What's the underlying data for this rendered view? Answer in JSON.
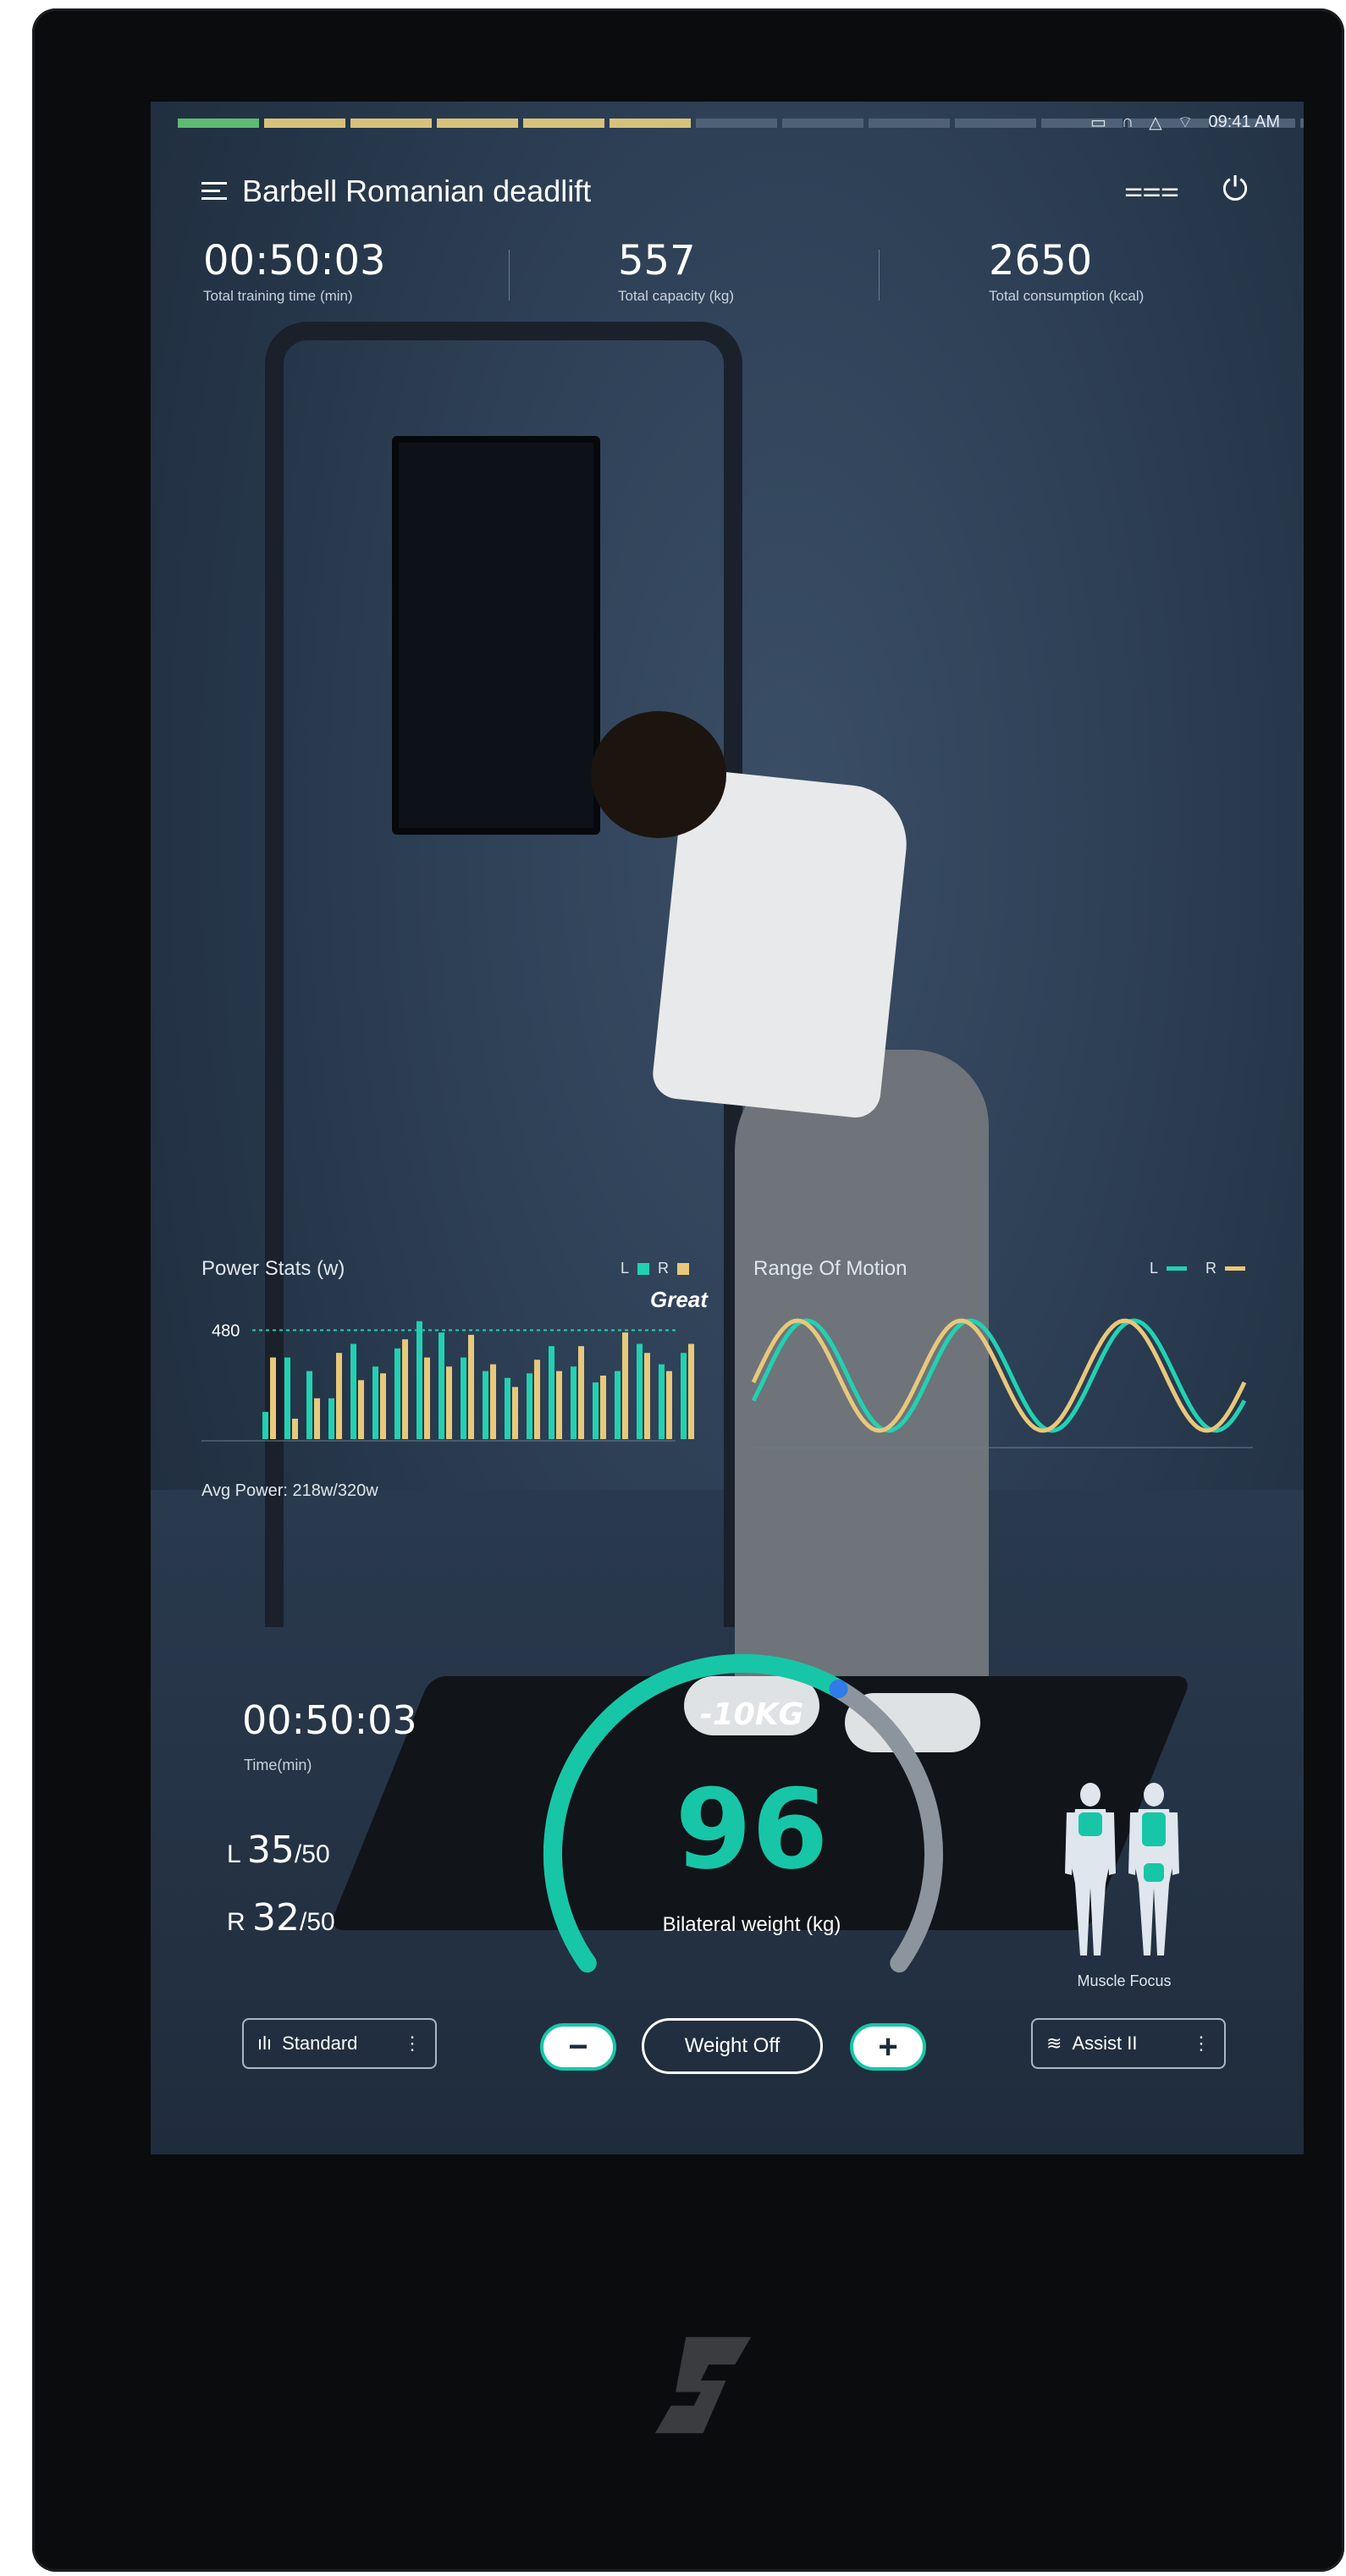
{
  "status_bar": {
    "time": "09:41 AM",
    "icons": [
      "cast-icon",
      "headphones-icon",
      "alert-icon",
      "wifi-icon"
    ],
    "progress_colors": [
      "#5dbb72",
      "#d7c27b",
      "#d7c27b",
      "#d7c27b",
      "#d7c27b",
      "#d7c27b",
      "#4f6177",
      "#4f6177",
      "#4f6177",
      "#4f6177",
      "#4f6177",
      "#4f6177",
      "#4f6177",
      "#4f6177",
      "#4f6177"
    ],
    "progress_completed_segments": 6
  },
  "header": {
    "title": "Barbell Romanian deadlift",
    "icons": [
      "menu-icon",
      "unlink-icon",
      "power-icon"
    ]
  },
  "stats": {
    "training_time": {
      "value": "00:50:03",
      "label": "Total training time (min)"
    },
    "capacity": {
      "value": "557",
      "label": "Total capacity (kg)"
    },
    "consumption": {
      "value": "2650",
      "label": "Total consumption (kcal)"
    }
  },
  "power": {
    "title": "Power Stats (w)",
    "legend_l": "L",
    "legend_r": "R",
    "reference_label": "480",
    "avg_label": "Avg Power:",
    "avg_value": "218w/320w",
    "feedback": "Great"
  },
  "rom": {
    "title": "Range Of Motion",
    "legend_l": "L",
    "legend_r": "R"
  },
  "session": {
    "time": "00:50:03",
    "time_label": "Time(min)",
    "left_prefix": "L",
    "left_value": "35",
    "left_total": "/50",
    "right_prefix": "R",
    "right_value": "32",
    "right_total": "/50"
  },
  "weight": {
    "delta": "-10KG",
    "value": "96",
    "label": "Bilateral weight (kg)",
    "arc_fraction": 0.62
  },
  "controls": {
    "mode": "Standard",
    "minus": "−",
    "weight_off": "Weight Off",
    "plus": "+",
    "assist": "Assist II"
  },
  "muscle": {
    "label": "Muscle Focus"
  },
  "colors": {
    "accent": "#17c6a7",
    "left_series": "#22d1b2",
    "right_series": "#e8c87a"
  },
  "chart_data": [
    {
      "type": "bar",
      "title": "Power Stats (w)",
      "series": [
        {
          "name": "L",
          "values": [
            120,
            360,
            300,
            180,
            420,
            320,
            400,
            520,
            470,
            360,
            300,
            270,
            290,
            410,
            320,
            250,
            300,
            420,
            330,
            380
          ]
        },
        {
          "name": "R",
          "values": [
            360,
            90,
            180,
            380,
            260,
            290,
            440,
            360,
            320,
            460,
            330,
            230,
            350,
            300,
            410,
            280,
            470,
            380,
            300,
            420
          ]
        }
      ],
      "reference_line": 480
    },
    {
      "type": "line",
      "title": "Range Of Motion",
      "series": [
        {
          "name": "L",
          "cycles": 3
        },
        {
          "name": "R",
          "cycles": 3
        }
      ]
    }
  ]
}
